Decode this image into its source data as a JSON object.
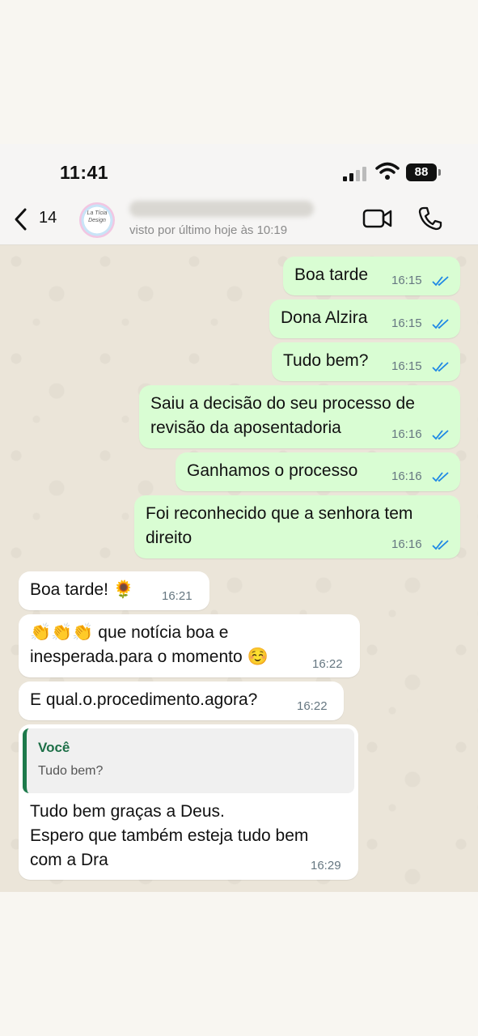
{
  "status_bar": {
    "time": "11:41",
    "battery": "88"
  },
  "header": {
    "back_count": "14",
    "avatar_text": "La Tícia Design",
    "contact_name": "",
    "last_seen": "visto por último hoje às 10:19"
  },
  "messages": [
    {
      "direction": "out",
      "lines": [
        "Boa tarde"
      ],
      "time": "16:15",
      "status": "read"
    },
    {
      "direction": "out",
      "lines": [
        "Dona Alzira"
      ],
      "time": "16:15",
      "status": "read"
    },
    {
      "direction": "out",
      "lines": [
        "Tudo bem?"
      ],
      "time": "16:15",
      "status": "read"
    },
    {
      "direction": "out",
      "lines": [
        "Saiu a decisão do seu processo de",
        "revisão da aposentadoria"
      ],
      "time": "16:16",
      "status": "read"
    },
    {
      "direction": "out",
      "lines": [
        "Ganhamos o processo"
      ],
      "time": "16:16",
      "status": "read"
    },
    {
      "direction": "out",
      "lines": [
        "Foi reconhecido que a senhora tem",
        "direito"
      ],
      "time": "16:16",
      "status": "read"
    },
    {
      "direction": "in",
      "lines": [
        "Boa tarde! 🌻"
      ],
      "time": "16:21"
    },
    {
      "direction": "in",
      "lines": [
        "👏👏👏 que notícia boa e",
        "inesperada.para o momento ☺️"
      ],
      "time": "16:22"
    },
    {
      "direction": "in",
      "lines": [
        "E qual.o.procedimento.agora?"
      ],
      "time": "16:22"
    },
    {
      "direction": "in",
      "quote": {
        "author": "Você",
        "text": "Tudo bem?"
      },
      "lines": [
        "Tudo bem graças a Deus.",
        "Espero que também esteja tudo bem",
        "com a Dra"
      ],
      "time": "16:29"
    }
  ],
  "colors": {
    "outgoing_bubble": "#d9fdd3",
    "incoming_bubble": "#ffffff",
    "read_ticks": "#1e88e5",
    "chat_background": "#ebe5d9"
  }
}
